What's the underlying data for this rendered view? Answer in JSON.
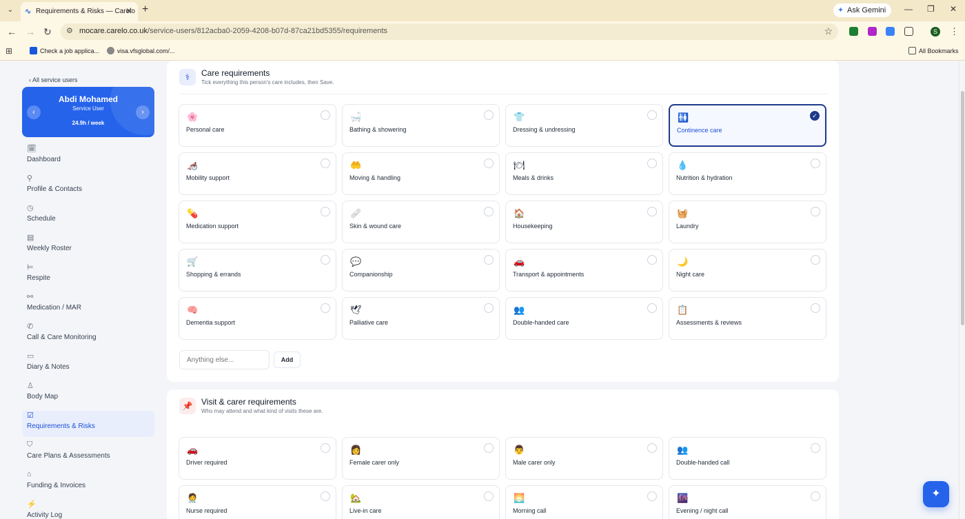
{
  "browser": {
    "tab_title": "Requirements & Risks — Carelo",
    "ask_gemini": "Ask Gemini",
    "url_host": "mocare.carelo.co.uk",
    "url_path": "/service-users/812acba0-2059-4208-b07d-87ca21bd5355/requirements",
    "bookmarks": [
      "Check a job applica...",
      "visa.vfsglobal.com/..."
    ],
    "all_bookmarks": "All Bookmarks",
    "profile_initial": "S"
  },
  "sidebar": {
    "back_label": "‹ All service users",
    "user": {
      "name": "Abdi Mohamed",
      "role": "Service User",
      "hours": "24.9h / week"
    },
    "items": [
      {
        "label": "Dashboard",
        "icon": "calendar-icon",
        "glyph": "🗓"
      },
      {
        "label": "Profile & Contacts",
        "icon": "person-icon",
        "glyph": "⚲"
      },
      {
        "label": "Schedule",
        "icon": "clock-icon",
        "glyph": "◷"
      },
      {
        "label": "Weekly Roster",
        "icon": "roster-icon",
        "glyph": "▤"
      },
      {
        "label": "Respite",
        "icon": "bed-icon",
        "glyph": "⊨"
      },
      {
        "label": "Medication / MAR",
        "icon": "pill-icon",
        "glyph": "⚯"
      },
      {
        "label": "Call & Care Monitoring",
        "icon": "phone-icon",
        "glyph": "✆"
      },
      {
        "label": "Diary & Notes",
        "icon": "notes-icon",
        "glyph": "▭"
      },
      {
        "label": "Body Map",
        "icon": "body-icon",
        "glyph": "♙"
      },
      {
        "label": "Requirements & Risks",
        "icon": "checkbox-icon",
        "glyph": "☑",
        "active": true
      },
      {
        "label": "Care Plans & Assessments",
        "icon": "shield-icon",
        "glyph": "⛉"
      },
      {
        "label": "Funding & Invoices",
        "icon": "bank-icon",
        "glyph": "⌂"
      },
      {
        "label": "Activity Log",
        "icon": "activity-icon",
        "glyph": "⚡"
      }
    ]
  },
  "care_requirements": {
    "title": "Care requirements",
    "subtitle": "Tick everything this person's care includes, then Save.",
    "icon": "stethoscope-icon",
    "items": [
      {
        "label": "Personal care",
        "emoji": "🌸",
        "selected": false
      },
      {
        "label": "Bathing & showering",
        "emoji": "🛁",
        "selected": false
      },
      {
        "label": "Dressing & undressing",
        "emoji": "👕",
        "selected": false
      },
      {
        "label": "Continence care",
        "emoji": "🚻",
        "selected": true
      },
      {
        "label": "Mobility support",
        "emoji": "🦽",
        "selected": false
      },
      {
        "label": "Moving & handling",
        "emoji": "🤲",
        "selected": false
      },
      {
        "label": "Meals & drinks",
        "emoji": "🍽",
        "selected": false
      },
      {
        "label": "Nutrition & hydration",
        "emoji": "💧",
        "selected": false
      },
      {
        "label": "Medication support",
        "emoji": "💊",
        "selected": false
      },
      {
        "label": "Skin & wound care",
        "emoji": "🩹",
        "selected": false
      },
      {
        "label": "Housekeeping",
        "emoji": "🏠",
        "selected": false
      },
      {
        "label": "Laundry",
        "emoji": "🧺",
        "selected": false
      },
      {
        "label": "Shopping & errands",
        "emoji": "🛒",
        "selected": false
      },
      {
        "label": "Companionship",
        "emoji": "💬",
        "selected": false
      },
      {
        "label": "Transport & appointments",
        "emoji": "🚗",
        "selected": false
      },
      {
        "label": "Night care",
        "emoji": "🌙",
        "selected": false
      },
      {
        "label": "Dementia support",
        "emoji": "🧠",
        "selected": false
      },
      {
        "label": "Palliative care",
        "emoji": "🕊",
        "selected": false
      },
      {
        "label": "Double-handed care",
        "emoji": "👥",
        "selected": false
      },
      {
        "label": "Assessments & reviews",
        "emoji": "📋",
        "selected": false
      }
    ],
    "other_placeholder": "Anything else...",
    "add_label": "Add"
  },
  "visit_requirements": {
    "title": "Visit & carer requirements",
    "subtitle": "Who may attend and what kind of visits these are.",
    "icon": "pin-icon",
    "items": [
      {
        "label": "Driver required",
        "emoji": "🚗",
        "selected": false
      },
      {
        "label": "Female carer only",
        "emoji": "👩",
        "selected": false
      },
      {
        "label": "Male carer only",
        "emoji": "👨",
        "selected": false
      },
      {
        "label": "Double-handed call",
        "emoji": "👥",
        "selected": false
      },
      {
        "label": "Nurse required",
        "emoji": "🧑‍⚕️",
        "selected": false
      },
      {
        "label": "Live-in care",
        "emoji": "🏡",
        "selected": false
      },
      {
        "label": "Morning call",
        "emoji": "🌅",
        "selected": false
      },
      {
        "label": "Evening / night call",
        "emoji": "🌆",
        "selected": false
      }
    ]
  },
  "colors": {
    "accent": "#2563eb",
    "selected_border": "#1e3a8a",
    "page_bg": "#f3f5f8"
  }
}
